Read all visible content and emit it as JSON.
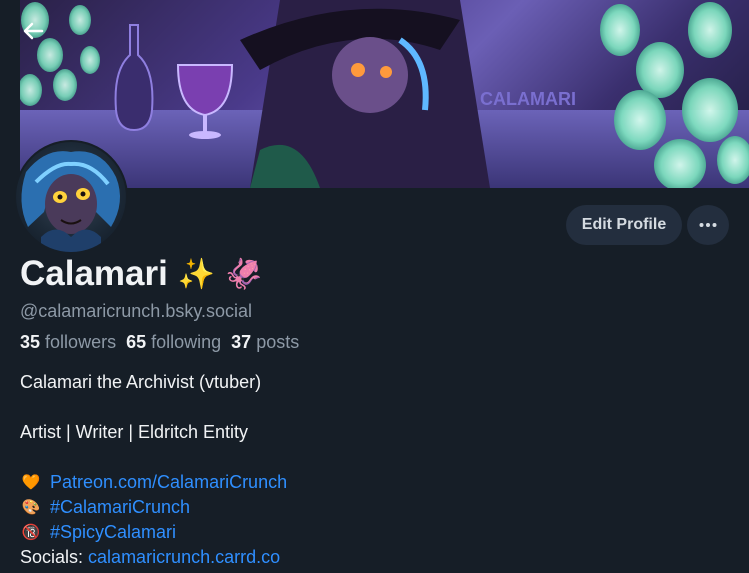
{
  "header": {
    "back_icon": "arrow-left-icon",
    "banner_watermark": "CALAMARI"
  },
  "profile": {
    "display_name": "Calamari",
    "name_emojis": [
      "✨",
      "🦑"
    ],
    "handle": "@calamaricrunch.bsky.social",
    "stats": {
      "followers_count": "35",
      "followers_label": "followers",
      "following_count": "65",
      "following_label": "following",
      "posts_count": "37",
      "posts_label": "posts"
    },
    "actions": {
      "edit_label": "Edit Profile",
      "more_label": "···"
    },
    "bio": {
      "line1": "Calamari the Archivist (vtuber)",
      "line2": "Artist | Writer | Eldritch Entity",
      "links": [
        {
          "emoji": "🧡",
          "text": "Patreon.com/CalamariCrunch"
        },
        {
          "emoji": "🎨",
          "text": "#CalamariCrunch"
        },
        {
          "emoji": "🔞",
          "text": "#SpicyCalamari"
        }
      ],
      "socials_label": "Socials:",
      "socials_link": "calamaricrunch.carrd.co"
    }
  },
  "colors": {
    "background": "#161e27",
    "button_bg": "#232e3e",
    "link": "#2f8fff",
    "muted": "#8d99a6"
  }
}
